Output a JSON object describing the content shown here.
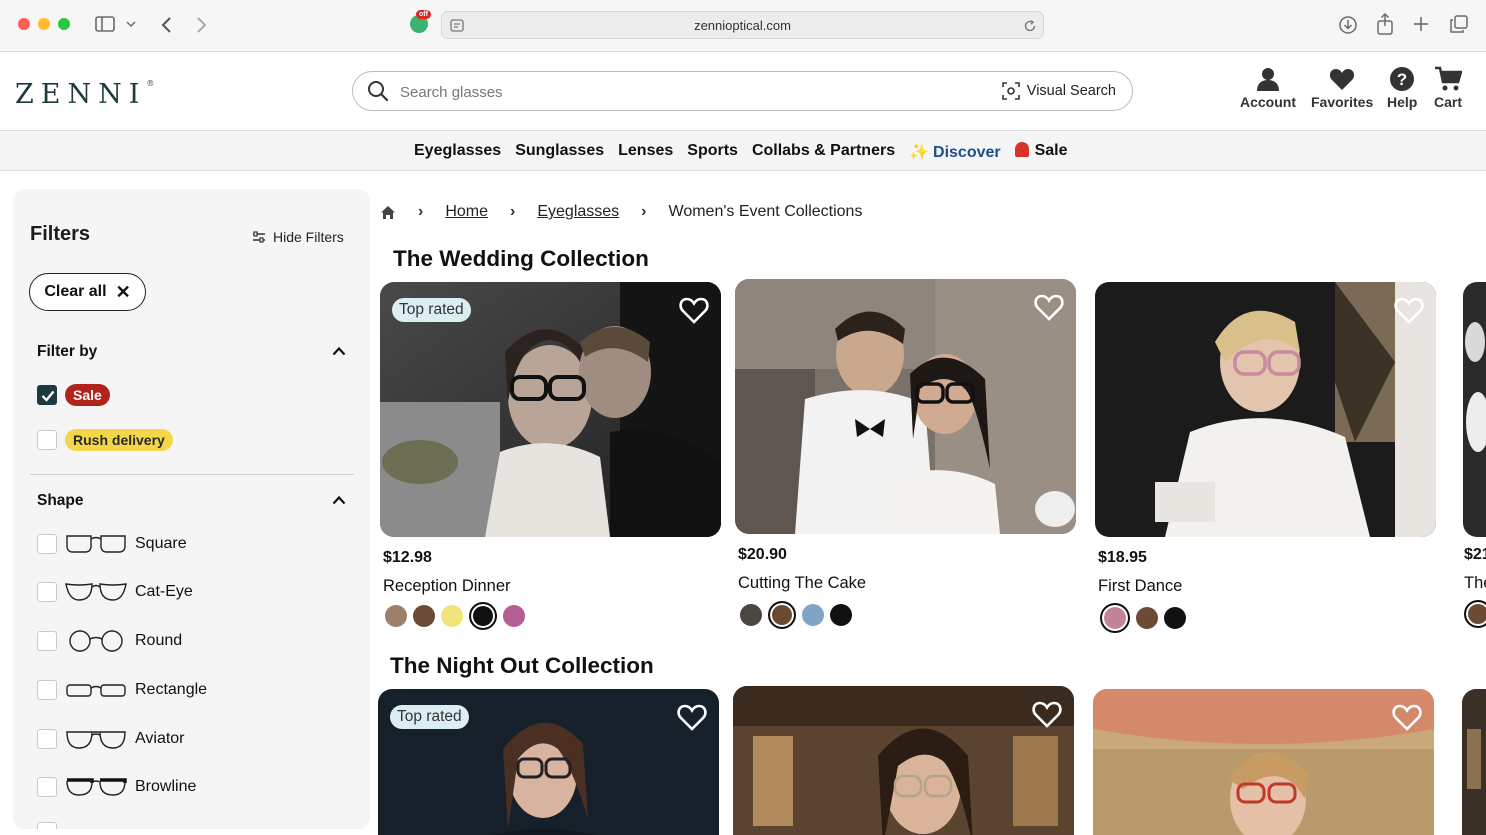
{
  "browser": {
    "url": "zennioptical.com",
    "extension_badge": "off"
  },
  "header": {
    "logo": "ZENNI",
    "logo_mark": "®",
    "search_placeholder": "Search glasses",
    "visual_search": "Visual Search",
    "actions": [
      {
        "label": "Account",
        "icon": "account-icon"
      },
      {
        "label": "Favorites",
        "icon": "heart-icon"
      },
      {
        "label": "Help",
        "icon": "help-icon"
      },
      {
        "label": "Cart",
        "icon": "cart-icon"
      }
    ]
  },
  "nav": {
    "items": [
      "Eyeglasses",
      "Sunglasses",
      "Lenses",
      "Sports",
      "Collabs & Partners",
      "Discover",
      "Sale"
    ]
  },
  "filters": {
    "title": "Filters",
    "hide_label": "Hide Filters",
    "clear_all": "Clear all",
    "filter_by_title": "Filter by",
    "filter_by_options": [
      {
        "label": "Sale",
        "checked": true,
        "color": "#b1241b"
      },
      {
        "label": "Rush delivery",
        "checked": false,
        "color": "#f4d64b"
      }
    ],
    "shape_title": "Shape",
    "shapes": [
      "Square",
      "Cat-Eye",
      "Round",
      "Rectangle",
      "Aviator",
      "Browline"
    ]
  },
  "breadcrumb": {
    "home": "Home",
    "eyeglasses": "Eyeglasses",
    "current": "Women's Event Collections"
  },
  "collections": [
    {
      "title": "The Wedding Collection",
      "products": [
        {
          "price": "$12.98",
          "name": "Reception Dinner",
          "badge": "Top rated",
          "swatches": [
            "#9b7f6a",
            "#6b4b36",
            "#f2e27a",
            "#111111",
            "#b45e93"
          ],
          "selected": 3
        },
        {
          "price": "$20.90",
          "name": "Cutting The Cake",
          "badge": "",
          "swatches": [
            "#4a4742",
            "#6b4a30",
            "#7fa4c6",
            "#111111"
          ],
          "selected": 1
        },
        {
          "price": "$18.95",
          "name": "First Dance",
          "badge": "",
          "swatches": [
            "#c3849b",
            "#6b4b36",
            "#111111"
          ],
          "selected": 0
        },
        {
          "price": "$21",
          "name": "The",
          "badge": "",
          "swatches": [
            "#6b4b36"
          ],
          "selected": 0
        }
      ]
    },
    {
      "title": "The Night Out Collection",
      "products": [
        {
          "badge": "Top rated"
        },
        {
          "badge": ""
        },
        {
          "badge": ""
        }
      ]
    }
  ]
}
